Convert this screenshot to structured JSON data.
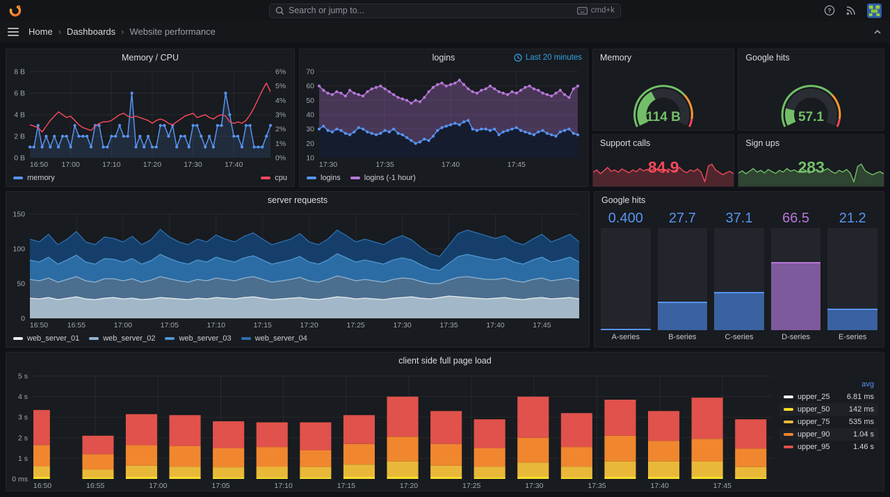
{
  "topbar": {
    "search_placeholder": "Search or jump to...",
    "shortcut_label": "cmd+k"
  },
  "breadcrumb": {
    "home": "Home",
    "section": "Dashboards",
    "page": "Website performance"
  },
  "colors": {
    "accent_blue": "#5794F2",
    "purple": "#B877D9",
    "green": "#73BF69",
    "red": "#F2495C",
    "orange": "#F0872F",
    "yellow": "#EAB839",
    "time_link": "#35A2E5"
  },
  "chart_data": [
    {
      "id": "mem_cpu",
      "type": "line",
      "title": "Memory / CPU",
      "x_ticks": [
        "16:50",
        "17:00",
        "17:10",
        "17:20",
        "17:30",
        "17:40"
      ],
      "tick_every": 10,
      "y_left": {
        "ticks": [
          "0 B",
          "2 B",
          "4 B",
          "6 B",
          "8 B"
        ],
        "min": 0,
        "max": 8
      },
      "y_right": {
        "ticks": [
          "0%",
          "1%",
          "2%",
          "3%",
          "4%",
          "5%",
          "6%"
        ],
        "min": 0,
        "max": 6
      },
      "series": [
        {
          "name": "memory",
          "color": "#5794F2",
          "axis": "left",
          "points": true,
          "fill": "rgba(87,148,242,0.14)",
          "values": [
            1,
            1,
            3,
            1,
            2,
            1,
            2,
            1,
            2,
            2,
            1,
            3,
            2,
            2,
            2,
            1,
            3,
            3,
            1,
            1,
            2,
            2,
            3,
            2,
            2,
            6,
            1,
            2,
            1,
            2,
            1,
            1,
            3,
            3,
            2,
            3,
            1,
            2,
            2,
            1,
            3,
            3,
            2,
            1,
            2,
            1,
            3,
            3,
            6,
            4,
            2,
            2,
            1,
            3,
            3,
            1,
            1,
            1,
            2,
            3
          ]
        },
        {
          "name": "cpu",
          "color": "#F2495C",
          "axis": "right",
          "values": [
            2.3,
            2.2,
            2.1,
            1.8,
            2.2,
            2.6,
            2.9,
            3.2,
            3.0,
            2.8,
            2.9,
            2.6,
            2.3,
            2.1,
            2.0,
            1.9,
            2.2,
            2.4,
            2.5,
            2.5,
            2.6,
            2.8,
            3.0,
            3.1,
            2.9,
            2.8,
            2.9,
            2.8,
            2.7,
            2.6,
            2.4,
            2.6,
            2.7,
            2.6,
            2.4,
            2.3,
            2.5,
            2.7,
            2.9,
            3.0,
            3.1,
            2.8,
            2.9,
            3.0,
            2.8,
            2.7,
            2.9,
            3.0,
            2.9,
            2.5,
            2.4,
            2.5,
            2.4,
            2.6,
            3.0,
            3.5,
            4.1,
            4.7,
            5.2,
            4.6
          ]
        }
      ],
      "legend": [
        {
          "label": "memory",
          "color": "#5794F2"
        }
      ],
      "legend_right": [
        {
          "label": "cpu",
          "color": "#F2495C"
        }
      ]
    },
    {
      "id": "logins",
      "type": "line",
      "title": "logins",
      "time_range": "Last 20 minutes",
      "x_ticks": [
        "17:30",
        "17:35",
        "17:40",
        "17:45"
      ],
      "tick_every": 15,
      "y_left": {
        "ticks": [
          "10",
          "20",
          "30",
          "40",
          "50",
          "60",
          "70"
        ],
        "min": 10,
        "max": 70
      },
      "series": [
        {
          "name": "logins (-1 hour)",
          "color": "#B877D9",
          "axis": "left",
          "points": true,
          "fill": "rgba(184,119,217,0.30)",
          "values": [
            60,
            57,
            55,
            54,
            56,
            55,
            53,
            57,
            55,
            54,
            53,
            56,
            58,
            59,
            60,
            58,
            56,
            54,
            52,
            51,
            50,
            48,
            50,
            49,
            52,
            56,
            59,
            61,
            62,
            60,
            61,
            62,
            64,
            61,
            58,
            56,
            55,
            57,
            58,
            60,
            58,
            56,
            55,
            54,
            56,
            55,
            57,
            59,
            60,
            58,
            57,
            55,
            54,
            53,
            55,
            57,
            54,
            52,
            58,
            60
          ]
        },
        {
          "name": "logins",
          "color": "#5794F2",
          "axis": "left",
          "points": true,
          "fill": "rgba(19,27,44,0.95)",
          "values": [
            30,
            32,
            29,
            28,
            30,
            29,
            27,
            26,
            28,
            31,
            30,
            28,
            27,
            26,
            27,
            29,
            28,
            30,
            27,
            26,
            24,
            22,
            20,
            21,
            23,
            22,
            25,
            29,
            31,
            32,
            33,
            34,
            33,
            35,
            36,
            30,
            29,
            30,
            30,
            29,
            30,
            26,
            28,
            29,
            30,
            31,
            29,
            28,
            27,
            26,
            28,
            29,
            27,
            26,
            25,
            28,
            29,
            30,
            27,
            26
          ]
        }
      ],
      "legend": [
        {
          "label": "logins",
          "color": "#5794F2"
        },
        {
          "label": "logins (-1 hour)",
          "color": "#B877D9"
        }
      ]
    },
    {
      "id": "memory_gauge",
      "type": "gauge",
      "title": "Memory",
      "display": "114 B",
      "percent": 0.38,
      "value_color": "#73BF69",
      "thresholds": [
        {
          "to": 0.7,
          "color": "#73BF69"
        },
        {
          "to": 0.93,
          "color": "#FF9830"
        },
        {
          "to": 1,
          "color": "#F2495C"
        }
      ]
    },
    {
      "id": "google_gauge",
      "type": "gauge",
      "title": "Google hits",
      "display": "57.1",
      "percent": 0.17,
      "value_color": "#73BF69",
      "thresholds": [
        {
          "to": 0.7,
          "color": "#73BF69"
        },
        {
          "to": 0.93,
          "color": "#FF9830"
        },
        {
          "to": 1,
          "color": "#F2495C"
        }
      ]
    },
    {
      "id": "support_calls",
      "type": "stat",
      "title": "Support calls",
      "display": "84.9",
      "color": "#F2495C",
      "fill": "rgba(242,73,92,0.25)",
      "values": [
        55,
        60,
        52,
        58,
        65,
        57,
        60,
        55,
        62,
        58,
        54,
        60,
        56,
        63,
        58,
        61,
        57,
        64,
        60,
        55,
        58,
        62,
        57,
        60,
        65,
        58,
        54,
        60,
        57,
        62,
        55,
        35,
        68,
        72,
        60,
        55,
        50,
        54,
        57,
        52
      ]
    },
    {
      "id": "sign_ups",
      "type": "stat",
      "title": "Sign ups",
      "display": "283",
      "color": "#73BF69",
      "fill": "rgba(115,191,105,0.25)",
      "values": [
        50,
        55,
        48,
        54,
        60,
        52,
        56,
        50,
        58,
        53,
        49,
        56,
        52,
        60,
        54,
        57,
        52,
        60,
        56,
        50,
        54,
        58,
        52,
        56,
        60,
        53,
        49,
        56,
        52,
        58,
        50,
        30,
        65,
        70,
        55,
        50,
        46,
        50,
        53,
        48
      ]
    },
    {
      "id": "server_requests",
      "type": "stacked_area",
      "title": "server requests",
      "x_ticks": [
        "16:50",
        "16:55",
        "17:00",
        "17:05",
        "17:10",
        "17:15",
        "17:20",
        "17:25",
        "17:30",
        "17:35",
        "17:40",
        "17:45"
      ],
      "tick_every": 5,
      "y": {
        "ticks": [
          "0",
          "50",
          "100",
          "150"
        ],
        "min": 0,
        "max": 150
      },
      "series": [
        {
          "name": "web_server_01",
          "fill": "#A2B8C8",
          "edge": "#E8EEF2",
          "values": [
            29,
            28,
            30,
            27,
            29,
            31,
            28,
            27,
            29,
            30,
            28,
            29,
            27,
            28,
            30,
            29,
            28,
            27,
            29,
            28,
            30,
            29,
            28,
            30,
            31,
            29,
            27,
            28,
            29,
            30,
            28,
            27,
            29,
            31,
            30,
            28,
            29,
            28,
            27,
            29,
            30,
            31,
            29,
            28,
            30,
            32,
            31,
            30,
            29,
            28,
            29,
            30,
            28,
            27,
            29,
            30,
            28,
            29,
            30,
            28
          ]
        },
        {
          "name": "web_server_02",
          "fill": "#4C6E8F",
          "edge": "#8FB4D0",
          "values": [
            27,
            26,
            28,
            25,
            27,
            29,
            26,
            25,
            28,
            27,
            26,
            28,
            25,
            27,
            30,
            28,
            26,
            25,
            27,
            26,
            28,
            27,
            26,
            28,
            29,
            27,
            25,
            26,
            27,
            29,
            26,
            25,
            27,
            30,
            28,
            26,
            27,
            26,
            25,
            27,
            28,
            26,
            24,
            22,
            20,
            23,
            28,
            30,
            29,
            28,
            27,
            28,
            26,
            25,
            27,
            28,
            26,
            27,
            28,
            26
          ]
        },
        {
          "name": "web_server_03",
          "fill": "#2C6CA4",
          "edge": "#4E97D1",
          "values": [
            28,
            27,
            30,
            26,
            28,
            31,
            27,
            26,
            29,
            28,
            27,
            29,
            26,
            28,
            32,
            29,
            27,
            26,
            28,
            27,
            30,
            28,
            27,
            29,
            30,
            28,
            26,
            27,
            28,
            30,
            27,
            26,
            28,
            32,
            29,
            27,
            28,
            27,
            26,
            28,
            29,
            27,
            24,
            21,
            19,
            24,
            30,
            32,
            31,
            30,
            28,
            29,
            27,
            26,
            28,
            30,
            27,
            28,
            30,
            27
          ]
        },
        {
          "name": "web_server_04",
          "fill": "#153F6A",
          "edge": "#2E6FB0",
          "values": [
            30,
            29,
            33,
            28,
            30,
            34,
            29,
            28,
            31,
            30,
            29,
            32,
            28,
            30,
            36,
            31,
            29,
            28,
            30,
            29,
            32,
            30,
            29,
            31,
            33,
            30,
            28,
            29,
            30,
            33,
            29,
            28,
            30,
            34,
            32,
            29,
            30,
            29,
            28,
            30,
            32,
            29,
            25,
            22,
            20,
            26,
            33,
            35,
            34,
            33,
            31,
            32,
            29,
            28,
            30,
            33,
            29,
            31,
            33,
            29
          ]
        }
      ],
      "legend": [
        {
          "label": "web_server_01",
          "color": "#E8EEF2"
        },
        {
          "label": "web_server_02",
          "color": "#8FB4D0"
        },
        {
          "label": "web_server_03",
          "color": "#4E97D1"
        },
        {
          "label": "web_server_04",
          "color": "#2E6FB0"
        }
      ]
    },
    {
      "id": "google_hits_bars",
      "type": "bar_gauge",
      "title": "Google hits",
      "max": 100,
      "bars": [
        {
          "label": "A-series",
          "display": "0.400",
          "value": 0.4,
          "fill": "#3A62A0",
          "edge": "#5794F2",
          "value_color": "#5794F2"
        },
        {
          "label": "B-series",
          "display": "27.7",
          "value": 27.7,
          "fill": "#3A62A0",
          "edge": "#5794F2",
          "value_color": "#5794F2"
        },
        {
          "label": "C-series",
          "display": "37.1",
          "value": 37.1,
          "fill": "#3A62A0",
          "edge": "#5794F2",
          "value_color": "#5794F2"
        },
        {
          "label": "D-series",
          "display": "66.5",
          "value": 66.5,
          "fill": "#7E5A9C",
          "edge": "#B877D9",
          "value_color": "#B877D9"
        },
        {
          "label": "E-series",
          "display": "21.2",
          "value": 21.2,
          "fill": "#3A62A0",
          "edge": "#5794F2",
          "value_color": "#5794F2"
        }
      ]
    },
    {
      "id": "page_load",
      "type": "stacked_bars",
      "title": "client side full page load",
      "x_ticks": [
        "16:50",
        "16:55",
        "17:00",
        "17:05",
        "17:10",
        "17:15",
        "17:20",
        "17:25",
        "17:30",
        "17:35",
        "17:40",
        "17:45"
      ],
      "total_minutes": 59,
      "tick_minutes": 5,
      "y": {
        "ticks": [
          "0 ms",
          "1 s",
          "2 s",
          "3 s",
          "4 s",
          "5 s"
        ],
        "min": 0,
        "max": 5
      },
      "segments": [
        {
          "name": "upper_50",
          "color": "#FADE2A"
        },
        {
          "name": "upper_75",
          "color": "#EAB839"
        },
        {
          "name": "upper_90",
          "color": "#F0872F"
        },
        {
          "name": "upper_95",
          "color": "#E0524B"
        }
      ],
      "bars": [
        [
          0.1,
          0.52,
          1.03,
          1.7
        ],
        [
          0.08,
          0.38,
          0.74,
          0.9
        ],
        [
          0.1,
          0.55,
          1.0,
          1.5
        ],
        [
          0.1,
          0.5,
          1.0,
          1.5
        ],
        [
          0.09,
          0.48,
          0.93,
          1.3
        ],
        [
          0.09,
          0.5,
          0.96,
          1.2
        ],
        [
          0.08,
          0.5,
          0.82,
          1.35
        ],
        [
          0.1,
          0.6,
          1.0,
          1.4
        ],
        [
          0.12,
          0.73,
          1.2,
          1.95
        ],
        [
          0.1,
          0.55,
          1.05,
          1.6
        ],
        [
          0.09,
          0.51,
          0.9,
          1.4
        ],
        [
          0.12,
          0.68,
          1.2,
          2.0
        ],
        [
          0.08,
          0.52,
          0.95,
          1.65
        ],
        [
          0.1,
          0.75,
          1.25,
          1.75
        ],
        [
          0.1,
          0.75,
          1.0,
          1.45
        ],
        [
          0.12,
          0.73,
          1.1,
          2.0
        ],
        [
          0.08,
          0.5,
          0.9,
          1.42
        ]
      ],
      "legend": {
        "header": "avg",
        "rows": [
          {
            "name": "upper_25",
            "color": "#F5F6F8",
            "avg": "6.81 ms"
          },
          {
            "name": "upper_50",
            "color": "#FADE2A",
            "avg": "142 ms"
          },
          {
            "name": "upper_75",
            "color": "#EAB839",
            "avg": "535 ms"
          },
          {
            "name": "upper_90",
            "color": "#F0872F",
            "avg": "1.04 s"
          },
          {
            "name": "upper_95",
            "color": "#E0524B",
            "avg": "1.46 s"
          }
        ]
      }
    }
  ]
}
